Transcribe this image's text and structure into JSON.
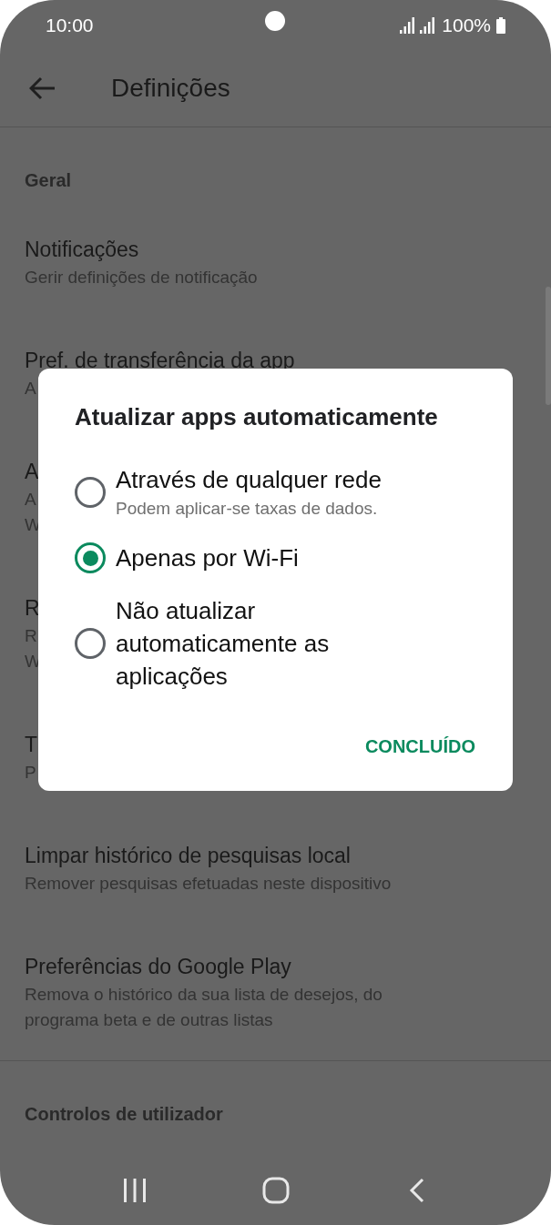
{
  "status_bar": {
    "time": "10:00",
    "battery": "100%"
  },
  "toolbar": {
    "title": "Definições"
  },
  "sections": [
    {
      "header": "Geral",
      "items": [
        {
          "title": "Notificações",
          "lines": [
            "Gerir definições de notificação"
          ]
        },
        {
          "title": "Pref. de transferência da app",
          "lines": [
            "A"
          ]
        },
        {
          "title": "A",
          "lines": [
            "A",
            "W"
          ]
        },
        {
          "title": "R",
          "lines": [
            "R",
            "W"
          ]
        },
        {
          "title": "T",
          "lines": [
            "P"
          ]
        },
        {
          "title": "Limpar histórico de pesquisas local",
          "lines": [
            "Remover pesquisas efetuadas neste dispositivo"
          ]
        },
        {
          "title": "Preferências do Google Play",
          "lines": [
            "Remova o histórico da sua lista de desejos, do",
            "programa beta e de outras listas"
          ]
        }
      ]
    },
    {
      "header": "Controlos de utilizador"
    }
  ],
  "dialog": {
    "title": "Atualizar apps automaticamente",
    "options": [
      {
        "label": "Através de qualquer rede",
        "hint": "Podem aplicar-se taxas de dados.",
        "selected": false
      },
      {
        "label": "Apenas por Wi-Fi",
        "selected": true
      },
      {
        "label": "Não atualizar automaticamente as aplicações",
        "selected": false
      }
    ],
    "button": "CONCLUÍDO"
  }
}
